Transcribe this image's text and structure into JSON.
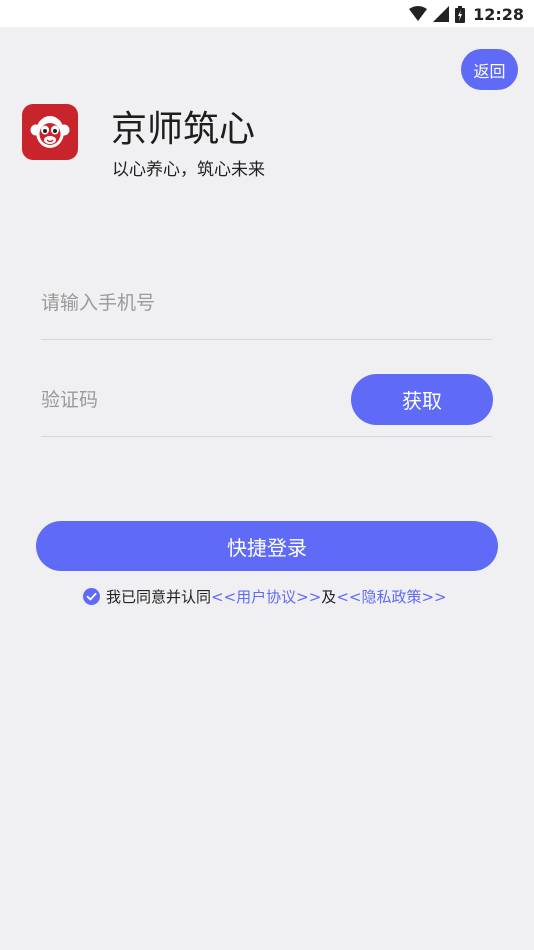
{
  "status_bar": {
    "time": "12:28",
    "icons": [
      "wifi-icon",
      "cell-signal-icon",
      "battery-icon"
    ]
  },
  "header": {
    "back_label": "返回"
  },
  "brand": {
    "name": "京师筑心",
    "slogan": "以心养心，筑心未来",
    "logo_icon": "monkey-face-logo"
  },
  "form": {
    "phone_placeholder": "请输入手机号",
    "phone_value": "",
    "code_placeholder": "验证码",
    "code_value": "",
    "get_code_label": "获取",
    "login_label": "快捷登录"
  },
  "agreement": {
    "checked": true,
    "text": "我已同意并认同",
    "user_agreement": "<<用户协议>>",
    "and": "及",
    "privacy_policy": "<<隐私政策>>"
  },
  "colors": {
    "accent": "#5f6bf7",
    "logo_bg": "#c8242b",
    "background": "#f0f0f2"
  }
}
